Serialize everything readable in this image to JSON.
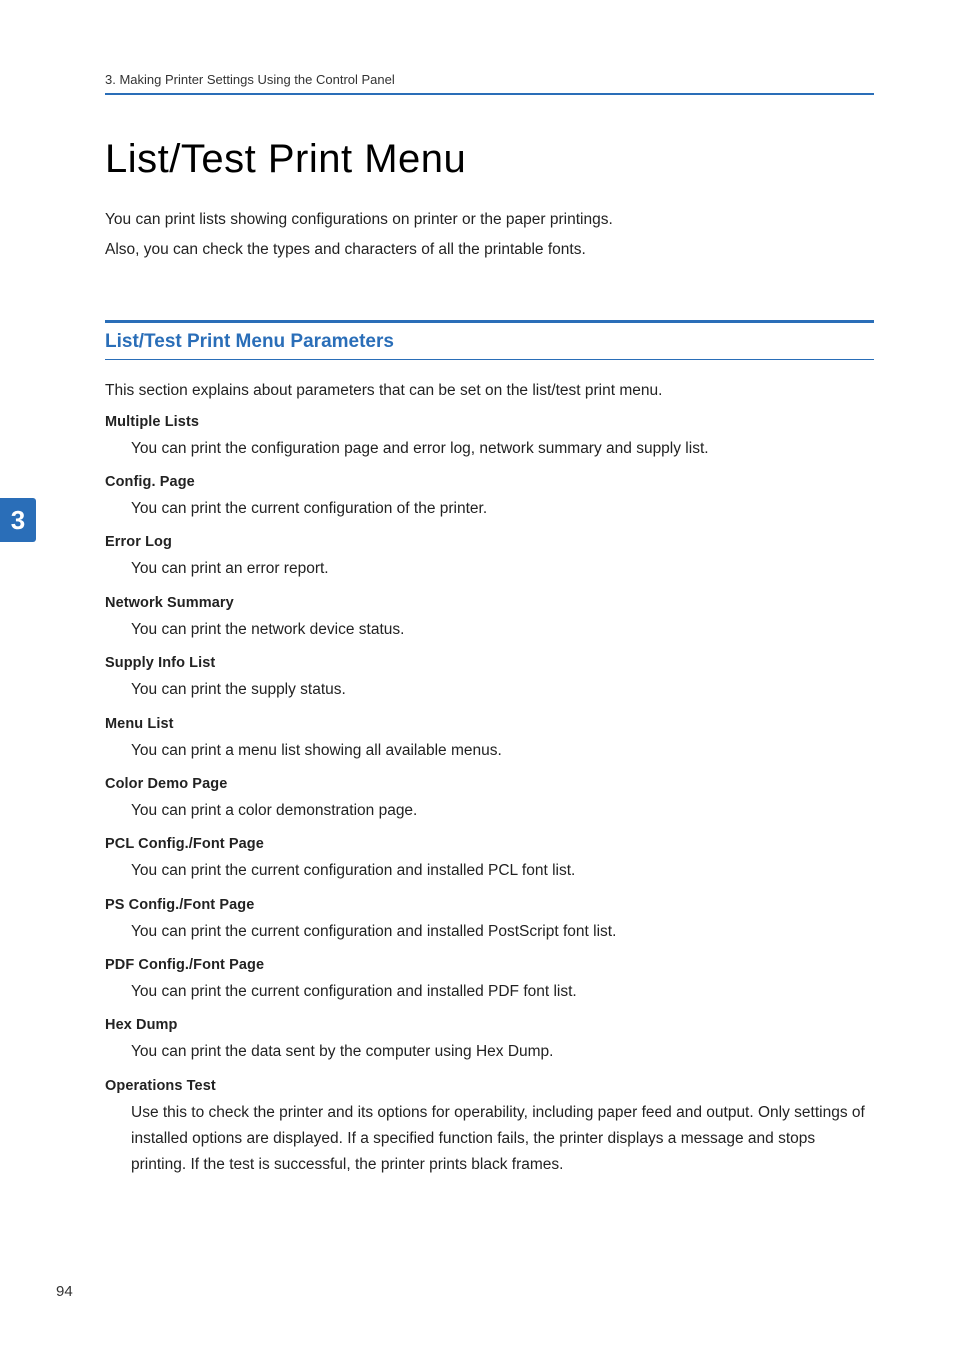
{
  "header": {
    "breadcrumb": "3. Making Printer Settings Using the Control Panel"
  },
  "title": "List/Test Print Menu",
  "intro": [
    "You can print lists showing configurations on printer or the paper printings.",
    "Also, you can check the types and characters of all the printable fonts."
  ],
  "section": {
    "heading": "List/Test Print Menu Parameters",
    "intro": "This section explains about parameters that can be set on the list/test print menu.",
    "params": [
      {
        "term": "Multiple Lists",
        "desc": "You can print the configuration page and error log, network summary and supply list."
      },
      {
        "term": "Config. Page",
        "desc": "You can print the current configuration of the printer."
      },
      {
        "term": "Error Log",
        "desc": "You can print an error report."
      },
      {
        "term": "Network Summary",
        "desc": "You can print the network device status."
      },
      {
        "term": "Supply Info List",
        "desc": "You can print the supply status."
      },
      {
        "term": "Menu List",
        "desc": "You can print a menu list showing all available menus."
      },
      {
        "term": "Color Demo Page",
        "desc": "You can print a color demonstration page."
      },
      {
        "term": "PCL Config./Font Page",
        "desc": "You can print the current configuration and installed PCL font list."
      },
      {
        "term": "PS Config./Font Page",
        "desc": "You can print the current configuration and installed PostScript font list."
      },
      {
        "term": "PDF Config./Font Page",
        "desc": "You can print the current configuration and installed PDF font list."
      },
      {
        "term": "Hex Dump",
        "desc": "You can print the data sent by the computer using Hex Dump."
      },
      {
        "term": "Operations Test",
        "desc": "Use this to check the printer and its options for operability, including paper feed and output. Only settings of installed options are displayed. If a specified function fails, the printer displays a message and stops printing. If the test is successful, the printer prints black frames."
      }
    ]
  },
  "tabNumber": "3",
  "pageNumber": "94"
}
